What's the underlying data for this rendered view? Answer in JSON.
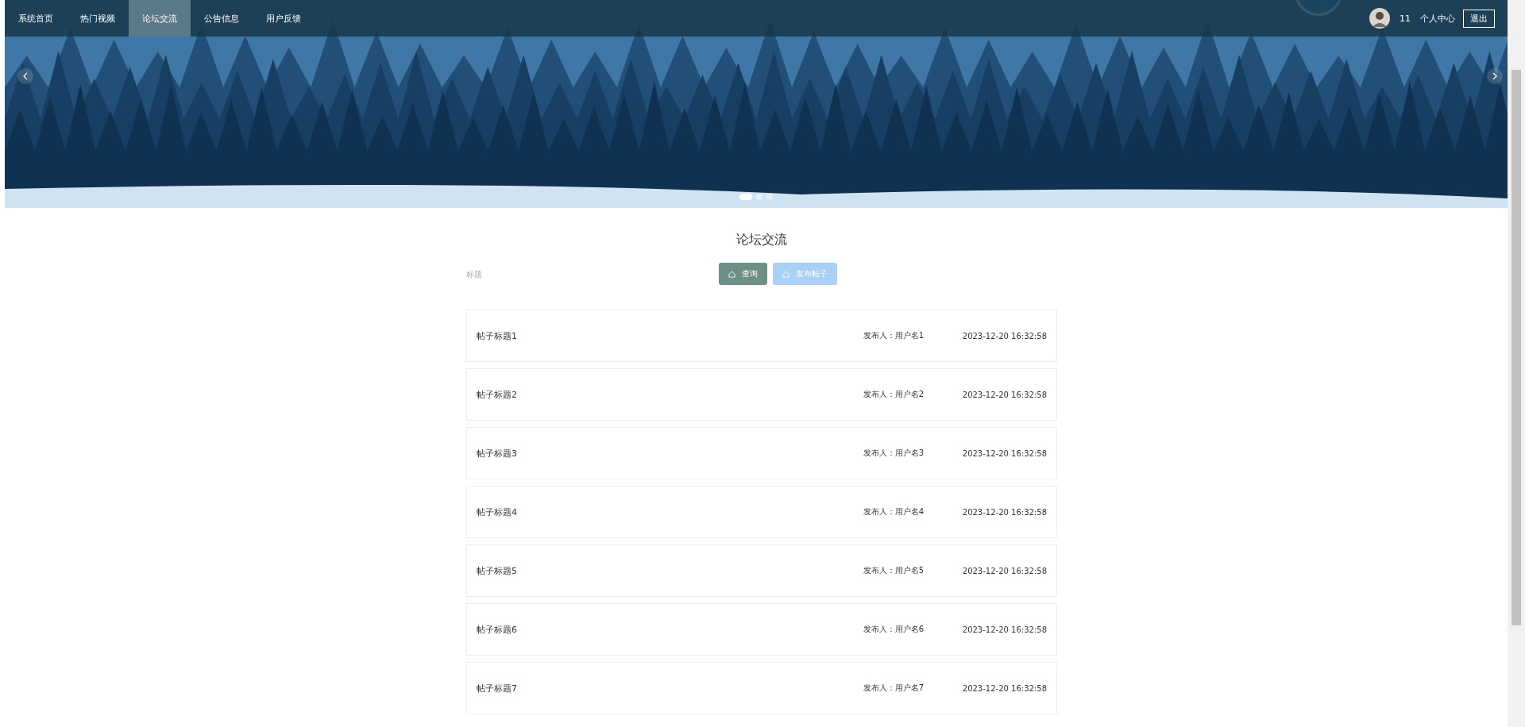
{
  "nav": {
    "items": [
      {
        "label": "系统首页",
        "selected": false
      },
      {
        "label": "热门视频",
        "selected": false
      },
      {
        "label": "论坛交流",
        "selected": true
      },
      {
        "label": "公告信息",
        "selected": false
      },
      {
        "label": "用户反馈",
        "selected": false
      }
    ],
    "user": {
      "name": "11"
    },
    "profile_link": "个人中心",
    "logout": "退出"
  },
  "carousel": {
    "dots": [
      {
        "selected": true
      },
      {
        "selected": false
      },
      {
        "selected": false
      }
    ]
  },
  "page_title": "论坛交流",
  "search": {
    "placeholder": "标题"
  },
  "buttons": [
    {
      "label": "查询",
      "kind": "query"
    },
    {
      "label": "发布帖子",
      "kind": "publish"
    }
  ],
  "posts": [
    {
      "title": "帖子标题1",
      "author": "发布人：用户名1",
      "time": "2023-12-20 16:32:58"
    },
    {
      "title": "帖子标题2",
      "author": "发布人：用户名2",
      "time": "2023-12-20 16:32:58"
    },
    {
      "title": "帖子标题3",
      "author": "发布人：用户名3",
      "time": "2023-12-20 16:32:58"
    },
    {
      "title": "帖子标题4",
      "author": "发布人：用户名4",
      "time": "2023-12-20 16:32:58"
    },
    {
      "title": "帖子标题5",
      "author": "发布人：用户名5",
      "time": "2023-12-20 16:32:58"
    },
    {
      "title": "帖子标题6",
      "author": "发布人：用户名6",
      "time": "2023-12-20 16:32:58"
    },
    {
      "title": "帖子标题7",
      "author": "发布人：用户名7",
      "time": "2023-12-20 16:32:58"
    }
  ]
}
